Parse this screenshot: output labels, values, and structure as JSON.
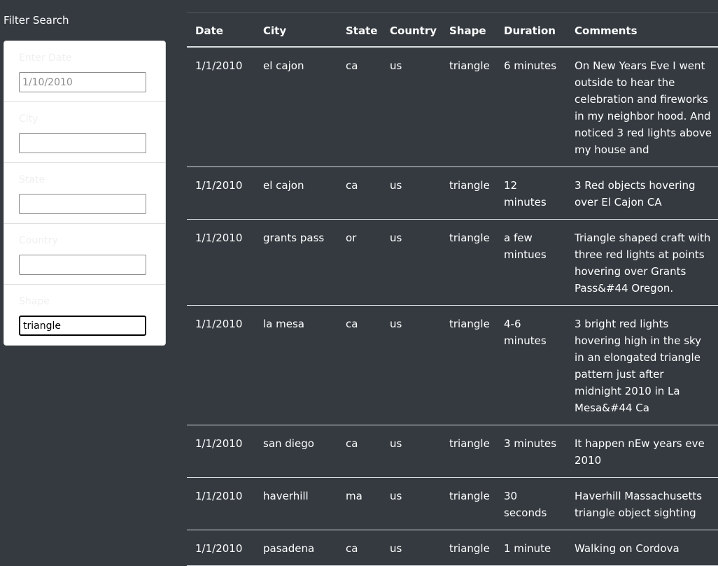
{
  "filter": {
    "title": "Filter Search",
    "fields": [
      {
        "label": "Enter Date",
        "value": "",
        "placeholder": "1/10/2010"
      },
      {
        "label": "City",
        "value": "",
        "placeholder": ""
      },
      {
        "label": "State",
        "value": "",
        "placeholder": ""
      },
      {
        "label": "Country",
        "value": "",
        "placeholder": ""
      },
      {
        "label": "Shape",
        "value": "triangle",
        "placeholder": ""
      }
    ]
  },
  "table": {
    "headers": {
      "date": "Date",
      "city": "City",
      "state": "State",
      "country": "Country",
      "shape": "Shape",
      "duration": "Duration",
      "comments": "Comments"
    },
    "rows": [
      {
        "date": "1/1/2010",
        "city": "el cajon",
        "state": "ca",
        "country": "us",
        "shape": "triangle",
        "duration": "6 minutes",
        "comments": "On New Years Eve I went outside to hear the celebration and fireworks in my neighbor hood. And noticed 3 red lights above my house and"
      },
      {
        "date": "1/1/2010",
        "city": "el cajon",
        "state": "ca",
        "country": "us",
        "shape": "triangle",
        "duration": "12 minutes",
        "comments": "3 Red objects hovering over El Cajon CA"
      },
      {
        "date": "1/1/2010",
        "city": "grants pass",
        "state": "or",
        "country": "us",
        "shape": "triangle",
        "duration": "a few mintues",
        "comments": "Triangle shaped craft with three red lights at points hovering over Grants Pass&#44 Oregon."
      },
      {
        "date": "1/1/2010",
        "city": "la mesa",
        "state": "ca",
        "country": "us",
        "shape": "triangle",
        "duration": "4-6 minutes",
        "comments": "3 bright red lights hovering high in the sky in an elongated triangle pattern just after midnight 2010 in La Mesa&#44 Ca"
      },
      {
        "date": "1/1/2010",
        "city": "san diego",
        "state": "ca",
        "country": "us",
        "shape": "triangle",
        "duration": "3 minutes",
        "comments": "It happen nEw years eve 2010"
      },
      {
        "date": "1/1/2010",
        "city": "haverhill",
        "state": "ma",
        "country": "us",
        "shape": "triangle",
        "duration": "30 seconds",
        "comments": "Haverhill Massachusetts triangle object sighting"
      },
      {
        "date": "1/1/2010",
        "city": "pasadena",
        "state": "ca",
        "country": "us",
        "shape": "triangle",
        "duration": "1 minute",
        "comments": "Walking on Cordova"
      }
    ]
  }
}
